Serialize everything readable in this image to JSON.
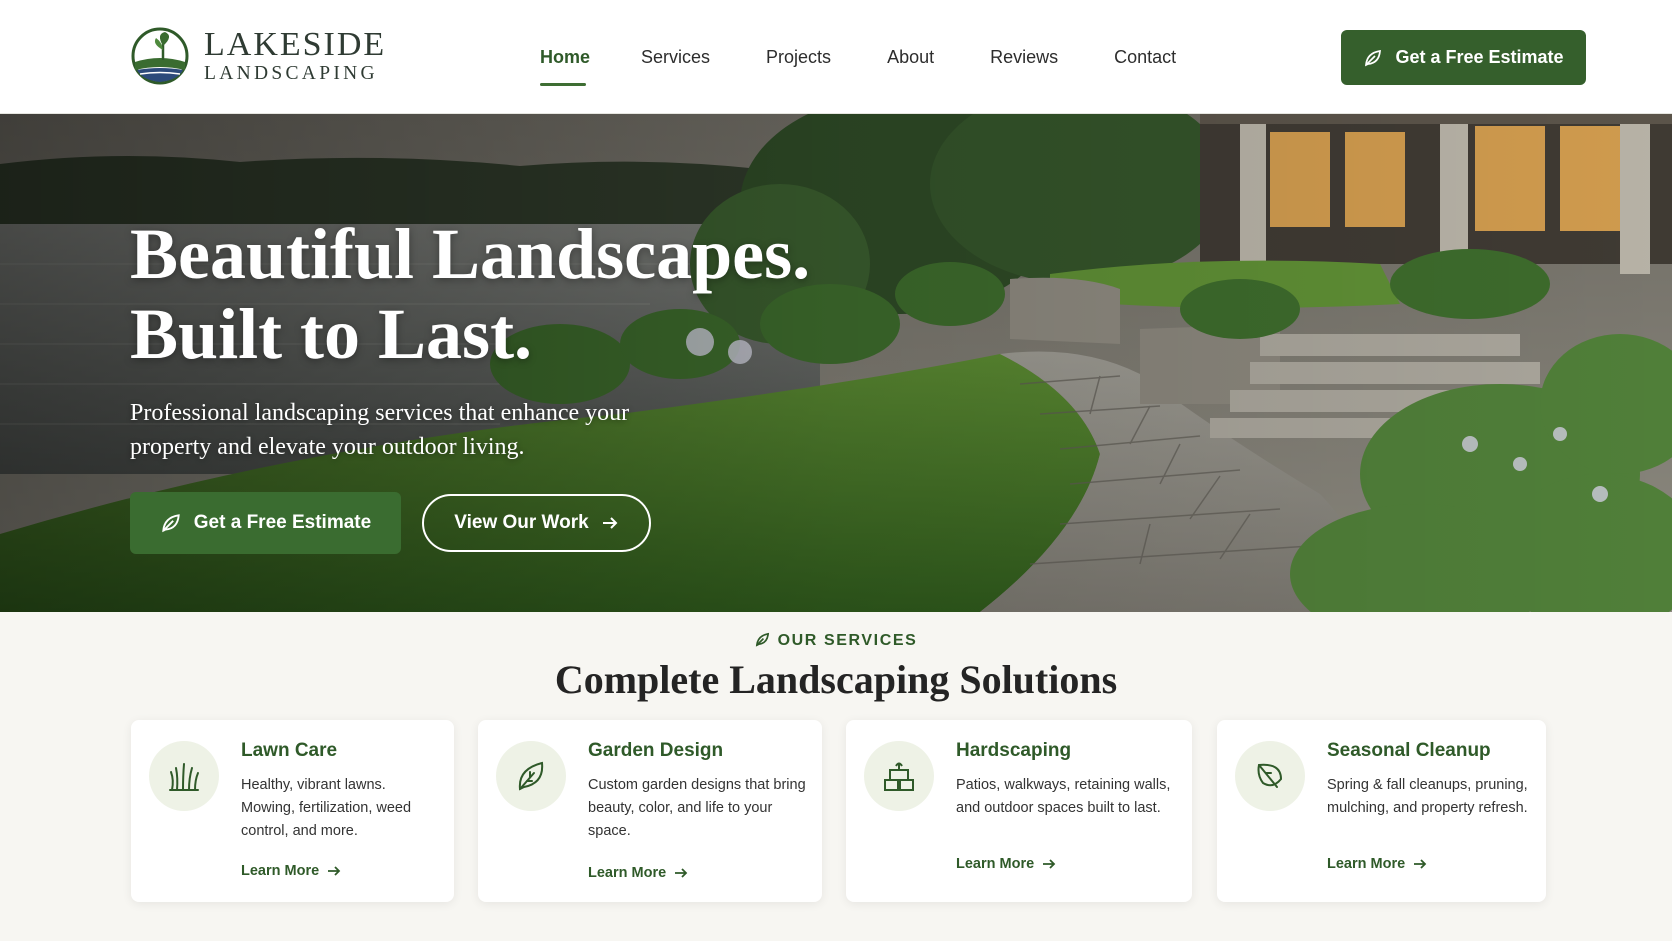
{
  "brand": {
    "line1": "LAKESIDE",
    "line2": "LANDSCAPING"
  },
  "nav": {
    "items": [
      {
        "label": "Home",
        "active": true
      },
      {
        "label": "Services"
      },
      {
        "label": "Projects"
      },
      {
        "label": "About"
      },
      {
        "label": "Reviews"
      },
      {
        "label": "Contact"
      }
    ]
  },
  "header": {
    "cta_label": "Get a Free Estimate"
  },
  "hero": {
    "title_line1": "Beautiful Landscapes.",
    "title_line2": "Built to Last.",
    "subtitle": "Professional landscaping services that enhance your property and elevate your outdoor living.",
    "primary_cta": "Get a Free Estimate",
    "secondary_cta": "View Our Work"
  },
  "services": {
    "eyebrow": "OUR SERVICES",
    "title": "Complete Landscaping Solutions",
    "cards": [
      {
        "icon": "grass-icon",
        "title": "Lawn Care",
        "description": "Healthy, vibrant lawns. Mowing, fertilization, weed control, and more.",
        "link": "Learn More"
      },
      {
        "icon": "leaf-icon",
        "title": "Garden Design",
        "description": "Custom garden designs that bring beauty, color, and life to your space.",
        "link": "Learn More"
      },
      {
        "icon": "pavers-icon",
        "title": "Hardscaping",
        "description": "Patios, walkways, retaining walls, and outdoor spaces built to last.",
        "link": "Learn More"
      },
      {
        "icon": "seasonal-leaf-icon",
        "title": "Seasonal Cleanup",
        "description": "Spring & fall cleanups, pruning, mulching, and property refresh.",
        "link": "Learn More"
      }
    ]
  },
  "colors": {
    "brand_green": "#355f2c",
    "accent_green": "#3a6c30",
    "icon_bg": "#eef2e6",
    "page_bg": "#f7f6f2"
  }
}
